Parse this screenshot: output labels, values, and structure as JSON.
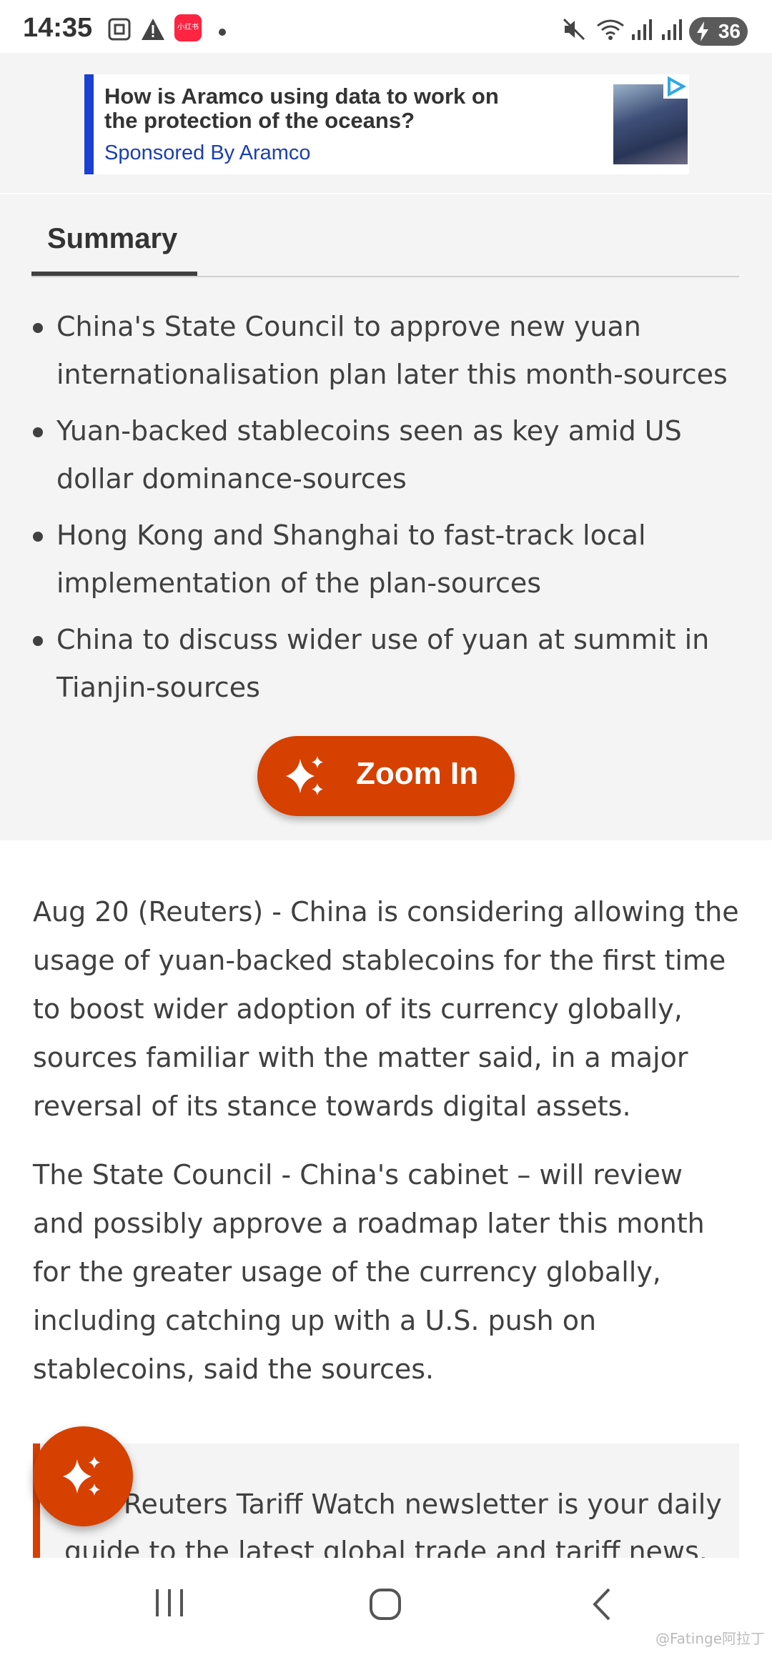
{
  "status_bar": {
    "time": "14:35",
    "notif_badge": "小红书",
    "battery": "36",
    "icons": [
      "screenshot-icon",
      "warning-icon",
      "app-icon",
      "dot-icon",
      "mute-icon",
      "wifi-icon",
      "signal-icon",
      "signal-icon",
      "battery-icon"
    ]
  },
  "ad": {
    "title": "How is Aramco using data to work on the protection of the oceans?",
    "sponsor": "Sponsored By Aramco",
    "accent": "#1a3fd3"
  },
  "summary": {
    "tab_label": "Summary",
    "bullets": [
      "China's State Council to approve new yuan internationalisation plan later this month-sources",
      "Yuan-backed stablecoins seen as key amid US dollar dominance-sources",
      "Hong Kong and Shanghai to fast-track local implementation of the plan-sources",
      "China to discuss wider use of yuan at summit in Tianjin-sources"
    ],
    "zoom_label": "Zoom In"
  },
  "article": {
    "paragraphs": [
      "Aug 20 (Reuters) - China is considering allowing the usage of yuan-backed stablecoins for the first time to boost wider adoption of its currency globally, sources familiar with the matter said, in a major reversal of its stance towards digital assets.",
      "The State Council - China's cabinet – will review and possibly approve a roadmap later this month for the greater usage of the currency globally, including catching up with a U.S. push on stablecoins, said the sources."
    ],
    "newsletter_text": "The Reuters Tariff Watch newsletter is your daily guide to the latest global trade and tariff news."
  },
  "navbar": {
    "buttons": [
      "recent-apps",
      "home",
      "back"
    ]
  },
  "watermark": "@Fatinge阿拉丁",
  "colors": {
    "brand_orange": "#d64000",
    "text": "#404040",
    "panel_bg": "#f4f4f4"
  }
}
